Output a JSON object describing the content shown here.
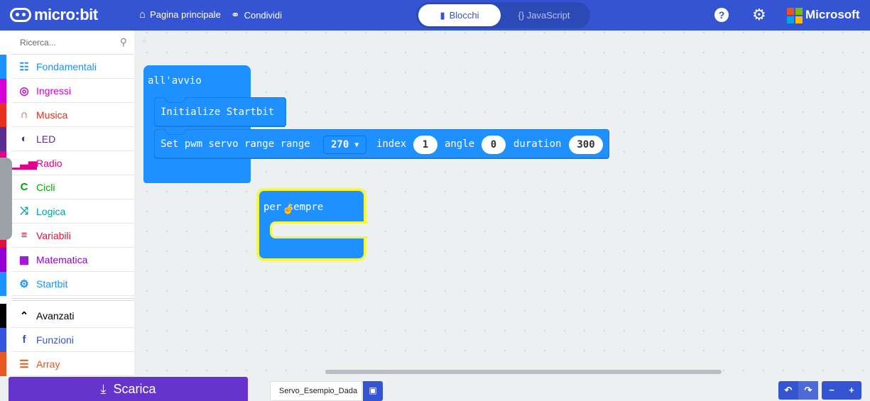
{
  "header": {
    "logo_text": "micro:bit",
    "home_label": "Pagina principale",
    "share_label": "Condividi",
    "blocks_label": "Blocchi",
    "javascript_label": "{} JavaScript",
    "help_glyph": "?",
    "brand_label": "Microsoft",
    "brand_colors": [
      "#f25022",
      "#7fba00",
      "#00a4ef",
      "#ffb900"
    ]
  },
  "toolbox": {
    "search_placeholder": "Ricerca...",
    "categories": [
      {
        "label": "Fondamentali",
        "icon": "grid-icon",
        "color": "#1e90ff"
      },
      {
        "label": "Ingressi",
        "icon": "target-icon",
        "color": "#d400d4"
      },
      {
        "label": "Musica",
        "icon": "headphones-icon",
        "color": "#e63022"
      },
      {
        "label": "LED",
        "icon": "toggle-icon",
        "color": "#5c2d91"
      },
      {
        "label": "Radio",
        "icon": "signal-icon",
        "color": "#e3008c"
      },
      {
        "label": "Cicli",
        "icon": "loop-icon",
        "color": "#00aa00"
      },
      {
        "label": "Logica",
        "icon": "shuffle-icon",
        "color": "#00a4a6"
      },
      {
        "label": "Variabili",
        "icon": "lines-icon",
        "color": "#dc143c"
      },
      {
        "label": "Matematica",
        "icon": "calculator-icon",
        "color": "#9400d3"
      },
      {
        "label": "Startbit",
        "icon": "gear-icon",
        "color": "#1e90ff"
      }
    ],
    "advanced": [
      {
        "label": "Avanzati",
        "icon": "chevron-up-icon",
        "color": "#000000"
      },
      {
        "label": "Funzioni",
        "icon": "function-icon",
        "color": "#3455db"
      },
      {
        "label": "Array",
        "icon": "list-icon",
        "color": "#e65722"
      }
    ]
  },
  "workspace": {
    "on_start_label": "all'avvio",
    "init_label": "Initialize Startbit",
    "servo_block": {
      "prefix": "Set pwm servo range range",
      "range_value": "270",
      "index_label": "index",
      "index_value": "1",
      "angle_label": "angle",
      "angle_value": "0",
      "duration_label": "duration",
      "duration_value": "300"
    },
    "forever_label": "per sempre"
  },
  "footer": {
    "download_label": "Scarica",
    "project_name": "Servo_Esempio_Dada",
    "undo_glyph": "↶",
    "redo_glyph": "↷",
    "zoom_out_glyph": "−",
    "zoom_in_glyph": "+"
  }
}
